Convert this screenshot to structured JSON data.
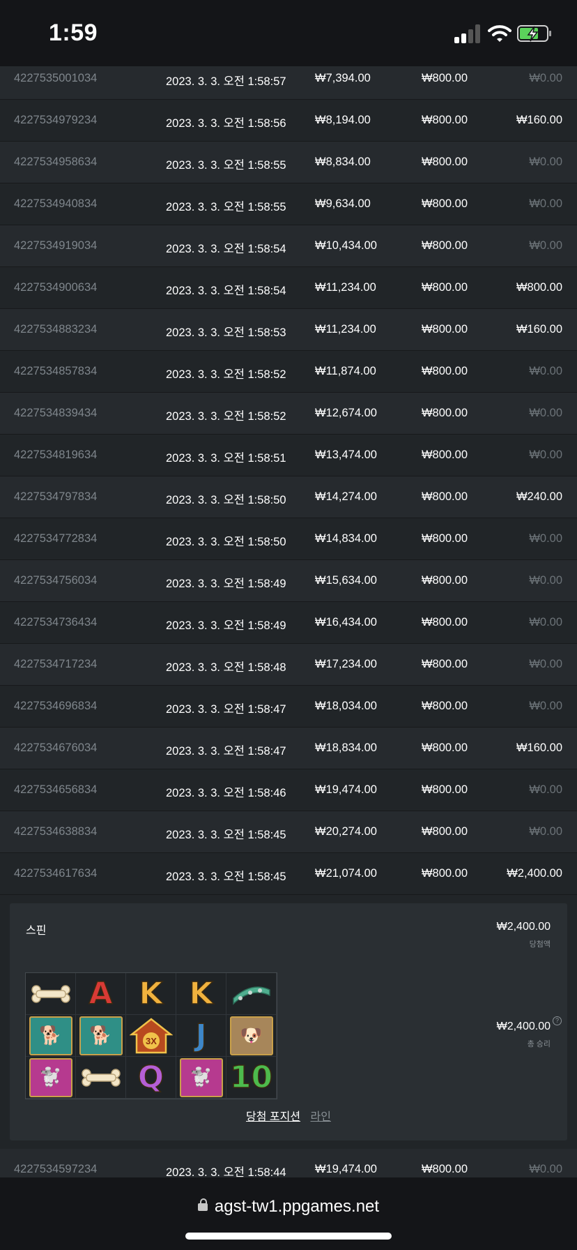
{
  "status_bar": {
    "time": "1:59"
  },
  "rows_before": [
    {
      "id": "4227535001034",
      "date": "2023. 3. 3. 오전 1:58:57",
      "balance": "₩7,394.00",
      "bet": "₩800.00",
      "win": "₩0.00",
      "zero": true
    },
    {
      "id": "4227534979234",
      "date": "2023. 3. 3. 오전 1:58:56",
      "balance": "₩8,194.00",
      "bet": "₩800.00",
      "win": "₩160.00",
      "zero": false
    },
    {
      "id": "4227534958634",
      "date": "2023. 3. 3. 오전 1:58:55",
      "balance": "₩8,834.00",
      "bet": "₩800.00",
      "win": "₩0.00",
      "zero": true
    },
    {
      "id": "4227534940834",
      "date": "2023. 3. 3. 오전 1:58:55",
      "balance": "₩9,634.00",
      "bet": "₩800.00",
      "win": "₩0.00",
      "zero": true
    },
    {
      "id": "4227534919034",
      "date": "2023. 3. 3. 오전 1:58:54",
      "balance": "₩10,434.00",
      "bet": "₩800.00",
      "win": "₩0.00",
      "zero": true
    },
    {
      "id": "4227534900634",
      "date": "2023. 3. 3. 오전 1:58:54",
      "balance": "₩11,234.00",
      "bet": "₩800.00",
      "win": "₩800.00",
      "zero": false
    },
    {
      "id": "4227534883234",
      "date": "2023. 3. 3. 오전 1:58:53",
      "balance": "₩11,234.00",
      "bet": "₩800.00",
      "win": "₩160.00",
      "zero": false
    },
    {
      "id": "4227534857834",
      "date": "2023. 3. 3. 오전 1:58:52",
      "balance": "₩11,874.00",
      "bet": "₩800.00",
      "win": "₩0.00",
      "zero": true
    },
    {
      "id": "4227534839434",
      "date": "2023. 3. 3. 오전 1:58:52",
      "balance": "₩12,674.00",
      "bet": "₩800.00",
      "win": "₩0.00",
      "zero": true
    },
    {
      "id": "4227534819634",
      "date": "2023. 3. 3. 오전 1:58:51",
      "balance": "₩13,474.00",
      "bet": "₩800.00",
      "win": "₩0.00",
      "zero": true
    },
    {
      "id": "4227534797834",
      "date": "2023. 3. 3. 오전 1:58:50",
      "balance": "₩14,274.00",
      "bet": "₩800.00",
      "win": "₩240.00",
      "zero": false
    },
    {
      "id": "4227534772834",
      "date": "2023. 3. 3. 오전 1:58:50",
      "balance": "₩14,834.00",
      "bet": "₩800.00",
      "win": "₩0.00",
      "zero": true
    },
    {
      "id": "4227534756034",
      "date": "2023. 3. 3. 오전 1:58:49",
      "balance": "₩15,634.00",
      "bet": "₩800.00",
      "win": "₩0.00",
      "zero": true
    },
    {
      "id": "4227534736434",
      "date": "2023. 3. 3. 오전 1:58:49",
      "balance": "₩16,434.00",
      "bet": "₩800.00",
      "win": "₩0.00",
      "zero": true
    },
    {
      "id": "4227534717234",
      "date": "2023. 3. 3. 오전 1:58:48",
      "balance": "₩17,234.00",
      "bet": "₩800.00",
      "win": "₩0.00",
      "zero": true
    },
    {
      "id": "4227534696834",
      "date": "2023. 3. 3. 오전 1:58:47",
      "balance": "₩18,034.00",
      "bet": "₩800.00",
      "win": "₩0.00",
      "zero": true
    },
    {
      "id": "4227534676034",
      "date": "2023. 3. 3. 오전 1:58:47",
      "balance": "₩18,834.00",
      "bet": "₩800.00",
      "win": "₩160.00",
      "zero": false
    },
    {
      "id": "4227534656834",
      "date": "2023. 3. 3. 오전 1:58:46",
      "balance": "₩19,474.00",
      "bet": "₩800.00",
      "win": "₩0.00",
      "zero": true
    },
    {
      "id": "4227534638834",
      "date": "2023. 3. 3. 오전 1:58:45",
      "balance": "₩20,274.00",
      "bet": "₩800.00",
      "win": "₩0.00",
      "zero": true
    },
    {
      "id": "4227534617634",
      "date": "2023. 3. 3. 오전 1:58:45",
      "balance": "₩21,074.00",
      "bet": "₩800.00",
      "win": "₩2,400.00",
      "zero": false
    }
  ],
  "detail": {
    "title": "스핀",
    "win_amount": "₩2,400.00",
    "win_label": "당첨액",
    "total_amount": "₩2,400.00",
    "total_label": "총 승리",
    "help": "?",
    "tab_active": "당첨 포지션",
    "tab_inactive": "라인",
    "symbols": [
      [
        "bone",
        "A",
        "K",
        "K",
        "collar"
      ],
      [
        "beagle",
        "beagle",
        "doghouse-3x",
        "J",
        "pug"
      ],
      [
        "shihtzu",
        "bone",
        "Q",
        "shihtzu",
        "10"
      ]
    ],
    "multiplier_text": "3X"
  },
  "rows_after": [
    {
      "id": "4227534597234",
      "date": "2023. 3. 3. 오전 1:58:44",
      "balance": "₩19,474.00",
      "bet": "₩800.00",
      "win": "₩0.00",
      "zero": true
    }
  ],
  "browser": {
    "url": "agst-tw1.ppgames.net"
  },
  "colors": {
    "background": "#212528",
    "row_alt": "#262a2e",
    "muted": "#7f868c"
  }
}
